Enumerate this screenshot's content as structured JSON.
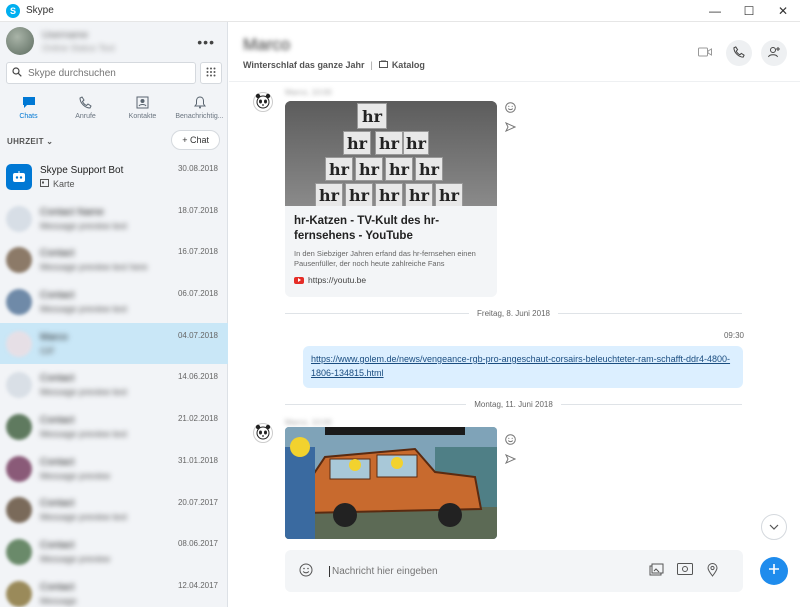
{
  "window": {
    "title": "Skype",
    "controls": {
      "minimize": "—",
      "maximize": "☐",
      "close": "✕"
    }
  },
  "profile": {
    "name": "Username",
    "status": "Online Status Text",
    "more_label": "•••"
  },
  "search": {
    "placeholder": "Skype durchsuchen",
    "icon": "search-icon",
    "dialpad_icon": "dialpad-icon"
  },
  "nav": {
    "tabs": [
      {
        "label": "Chats",
        "icon": "chat-icon",
        "active": true
      },
      {
        "label": "Anrufe",
        "icon": "phone-icon",
        "active": false
      },
      {
        "label": "Kontakte",
        "icon": "contacts-icon",
        "active": false
      },
      {
        "label": "Benachrichtig...",
        "icon": "bell-icon",
        "active": false
      }
    ]
  },
  "sort": {
    "label": "UHRZEIT",
    "new_chat_label": "+ Chat"
  },
  "chats": [
    {
      "name": "Skype Support Bot",
      "preview": "Karte",
      "date": "30.08.2018",
      "blurred": false,
      "selected": false,
      "avatar_color": "#0078d4"
    },
    {
      "name": "Contact Name",
      "preview": "Message preview text",
      "date": "18.07.2018",
      "blurred": true,
      "selected": false,
      "avatar_color": "#d7dee6"
    },
    {
      "name": "Contact",
      "preview": "Message preview text here",
      "date": "16.07.2018",
      "blurred": true,
      "selected": false,
      "avatar_color": "#8c7a68"
    },
    {
      "name": "Contact",
      "preview": "Message preview text",
      "date": "06.07.2018",
      "blurred": true,
      "selected": false,
      "avatar_color": "#6f8aa8"
    },
    {
      "name": "Marco",
      "preview": "GIF",
      "date": "04.07.2018",
      "blurred": true,
      "selected": true,
      "avatar_color": "#e6dfe6"
    },
    {
      "name": "Contact",
      "preview": "Message preview text",
      "date": "14.06.2018",
      "blurred": true,
      "selected": false,
      "avatar_color": "#d9dfe6"
    },
    {
      "name": "Contact",
      "preview": "Message preview text",
      "date": "21.02.2018",
      "blurred": true,
      "selected": false,
      "avatar_color": "#5f7a5f"
    },
    {
      "name": "Contact",
      "preview": "Message preview",
      "date": "31.01.2018",
      "blurred": true,
      "selected": false,
      "avatar_color": "#8a5a78"
    },
    {
      "name": "Contact",
      "preview": "Message preview text",
      "date": "20.07.2017",
      "blurred": true,
      "selected": false,
      "avatar_color": "#7a6a5a"
    },
    {
      "name": "Contact",
      "preview": "Message preview",
      "date": "08.06.2017",
      "blurred": true,
      "selected": false,
      "avatar_color": "#6a8a6a"
    },
    {
      "name": "Contact",
      "preview": "Message",
      "date": "12.04.2017",
      "blurred": true,
      "selected": false,
      "avatar_color": "#9a8a5a"
    }
  ],
  "conversation": {
    "contact_name": "Marco",
    "mood": "Winterschlaf das ganze Jahr",
    "catalog_label": "Katalog",
    "header_icons": [
      "video-call-icon",
      "phone-icon",
      "add-person-icon"
    ],
    "sender_label": "Marco, 10:00",
    "card": {
      "title": "hr-Katzen - TV-Kult des hr-fernsehens - YouTube",
      "description": "In den Siebziger Jahren erfand das hr-fernsehen einen Pausenfüller, der noch heute zahlreiche Fans",
      "link": "https://youtu.be",
      "thumb_text": "hr"
    },
    "date_divider_1": "Freitag, 8. Juni 2018",
    "time_1": "09:30",
    "link_message": "https://www.golem.de/news/vengeance-rgb-pro-angeschaut-corsairs-beleuchteter-ram-schafft-ddr4-4800-1806-134815.html",
    "date_divider_2": "Montag, 11. Juni 2018",
    "sender_label_2": "Marco, 10:00"
  },
  "composer": {
    "placeholder": "Nachricht hier eingeben",
    "icons": [
      "emoji-icon",
      "media-gallery-icon",
      "contact-card-icon",
      "location-icon",
      "send-icon"
    ]
  }
}
